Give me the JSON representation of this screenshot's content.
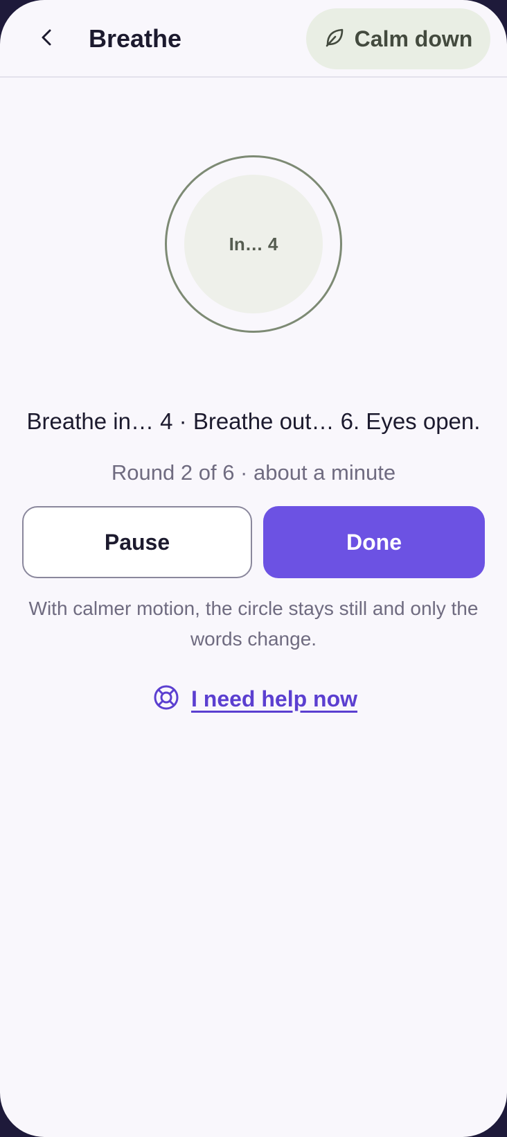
{
  "header": {
    "title": "Breathe",
    "calm_label": "Calm down",
    "back_icon": "chevron-left-icon",
    "calm_icon": "leaf-icon"
  },
  "breath_circle": {
    "label": "In… 4"
  },
  "main": {
    "instruction": "Breathe in… 4 · Breathe out… 6. Eyes open.",
    "round_status": "Round 2 of 6 · about a minute",
    "pause_label": "Pause",
    "done_label": "Done",
    "note": "With calmer motion, the circle stays still and only the words change.",
    "help_label": "I need help now",
    "help_icon": "lifebuoy-icon"
  },
  "colors": {
    "accent": "#6c52e3",
    "calm_bg": "#e9eee4",
    "ring": "#7d8a74",
    "background": "#f9f7fc"
  }
}
